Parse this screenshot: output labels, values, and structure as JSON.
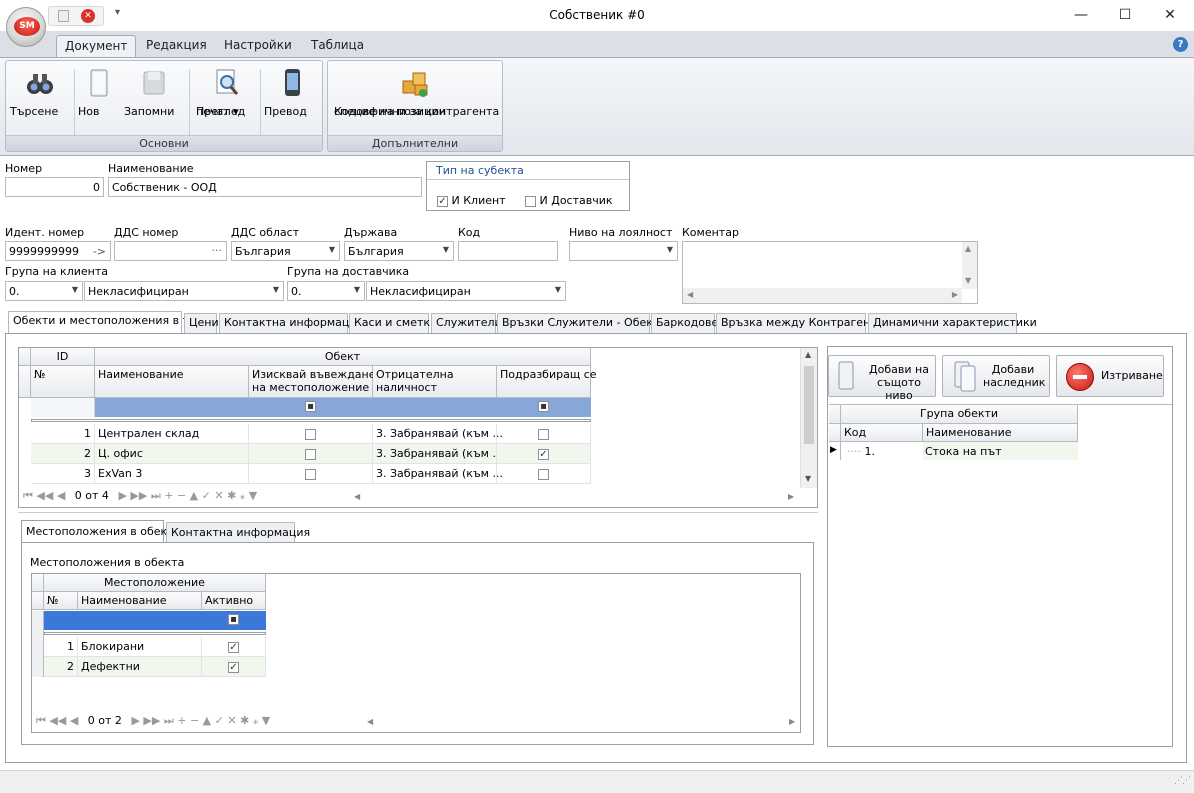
{
  "window": {
    "title": "Собственик #0",
    "minimize": "—",
    "maximize": "☐",
    "close": "✕",
    "orb": "SM"
  },
  "ribbon": {
    "tabs": [
      "Документ",
      "Редакция",
      "Настройки",
      "Таблица"
    ],
    "groups": {
      "main": "Основни",
      "extra": "Допълнителни"
    },
    "buttons": {
      "search": "Търсене",
      "new": "Нов",
      "save": "Запомни",
      "preview1": "Преглед",
      "preview2": "печат",
      "translate": "Превод",
      "codes1": "Кодове на позиции",
      "codes2": "специфични за контрагента"
    }
  },
  "form": {
    "number_label": "Номер",
    "number_value": "0",
    "name_label": "Наименование",
    "name_value": "Собственик - ООД",
    "subject_type_label": "Тип на субекта",
    "is_client_label": "И Клиент",
    "is_client": true,
    "is_supplier_label": "И Доставчик",
    "is_supplier": false,
    "ident_label": "Идент. номер",
    "ident_value": "9999999999",
    "ident_arrow": "->",
    "vat_label": "ДДС номер",
    "vat_dots": "···",
    "vat_region_label": "ДДС област",
    "vat_region_value": "България",
    "country_label": "Държава",
    "country_value": "България",
    "code_label": "Код",
    "loyalty_label": "Ниво на лоялност",
    "comment_label": "Коментар",
    "client_group_label": "Група на клиента",
    "client_group_code": "0.",
    "client_group_value": "Некласифициран",
    "supplier_group_label": "Група на доставчика",
    "supplier_group_code": "0.",
    "supplier_group_value": "Некласифициран"
  },
  "main_tabs": [
    "Обекти и местоположения в тях",
    "Цени",
    "Контактна информация",
    "Каси и сметки",
    "Служители",
    "Връзки Служители - Обекти",
    "Баркодове",
    "Връзка между Контрагенти",
    "Динамични характеристики"
  ],
  "objects_grid": {
    "group_id": "ID",
    "group_object": "Обект",
    "col_no": "№",
    "col_name": "Наименование",
    "col_require1": "Изисквай въвеждане",
    "col_require2": "на местоположение",
    "col_neg1": "Отрицателна",
    "col_neg2": "наличност",
    "col_default": "Подразбиращ се",
    "rows": [
      {
        "no": "1",
        "name": "Централен склад",
        "require": false,
        "negative": "3. Забранявай (към ...",
        "default": false
      },
      {
        "no": "2",
        "name": "Ц. офис",
        "require": false,
        "negative": "3. Забранявай (към ...",
        "default": true
      },
      {
        "no": "3",
        "name": "ExVan 3",
        "require": false,
        "negative": "3. Забранявай (към ...",
        "default": false
      }
    ],
    "nav_record": "0 от 4"
  },
  "sub_tabs": [
    "Местоположения в обекта",
    "Контактна информация"
  ],
  "locations": {
    "caption": "Местоположения в обекта",
    "group": "Местоположение",
    "col_no": "№",
    "col_name": "Наименование",
    "col_active": "Активно",
    "rows": [
      {
        "no": "1",
        "name": "Блокирани",
        "active": true
      },
      {
        "no": "2",
        "name": "Дефектни",
        "active": true
      }
    ],
    "nav_record": "0 от 2"
  },
  "right_panel": {
    "add_same1": "Добави на",
    "add_same2": "същото ниво",
    "add_child1": "Добави",
    "add_child2": "наследник",
    "delete": "Изтриване",
    "group_header": "Група обекти",
    "col_code": "Код",
    "col_name": "Наименование",
    "rows": [
      {
        "code": "1.",
        "name": "Стока на път"
      }
    ]
  }
}
